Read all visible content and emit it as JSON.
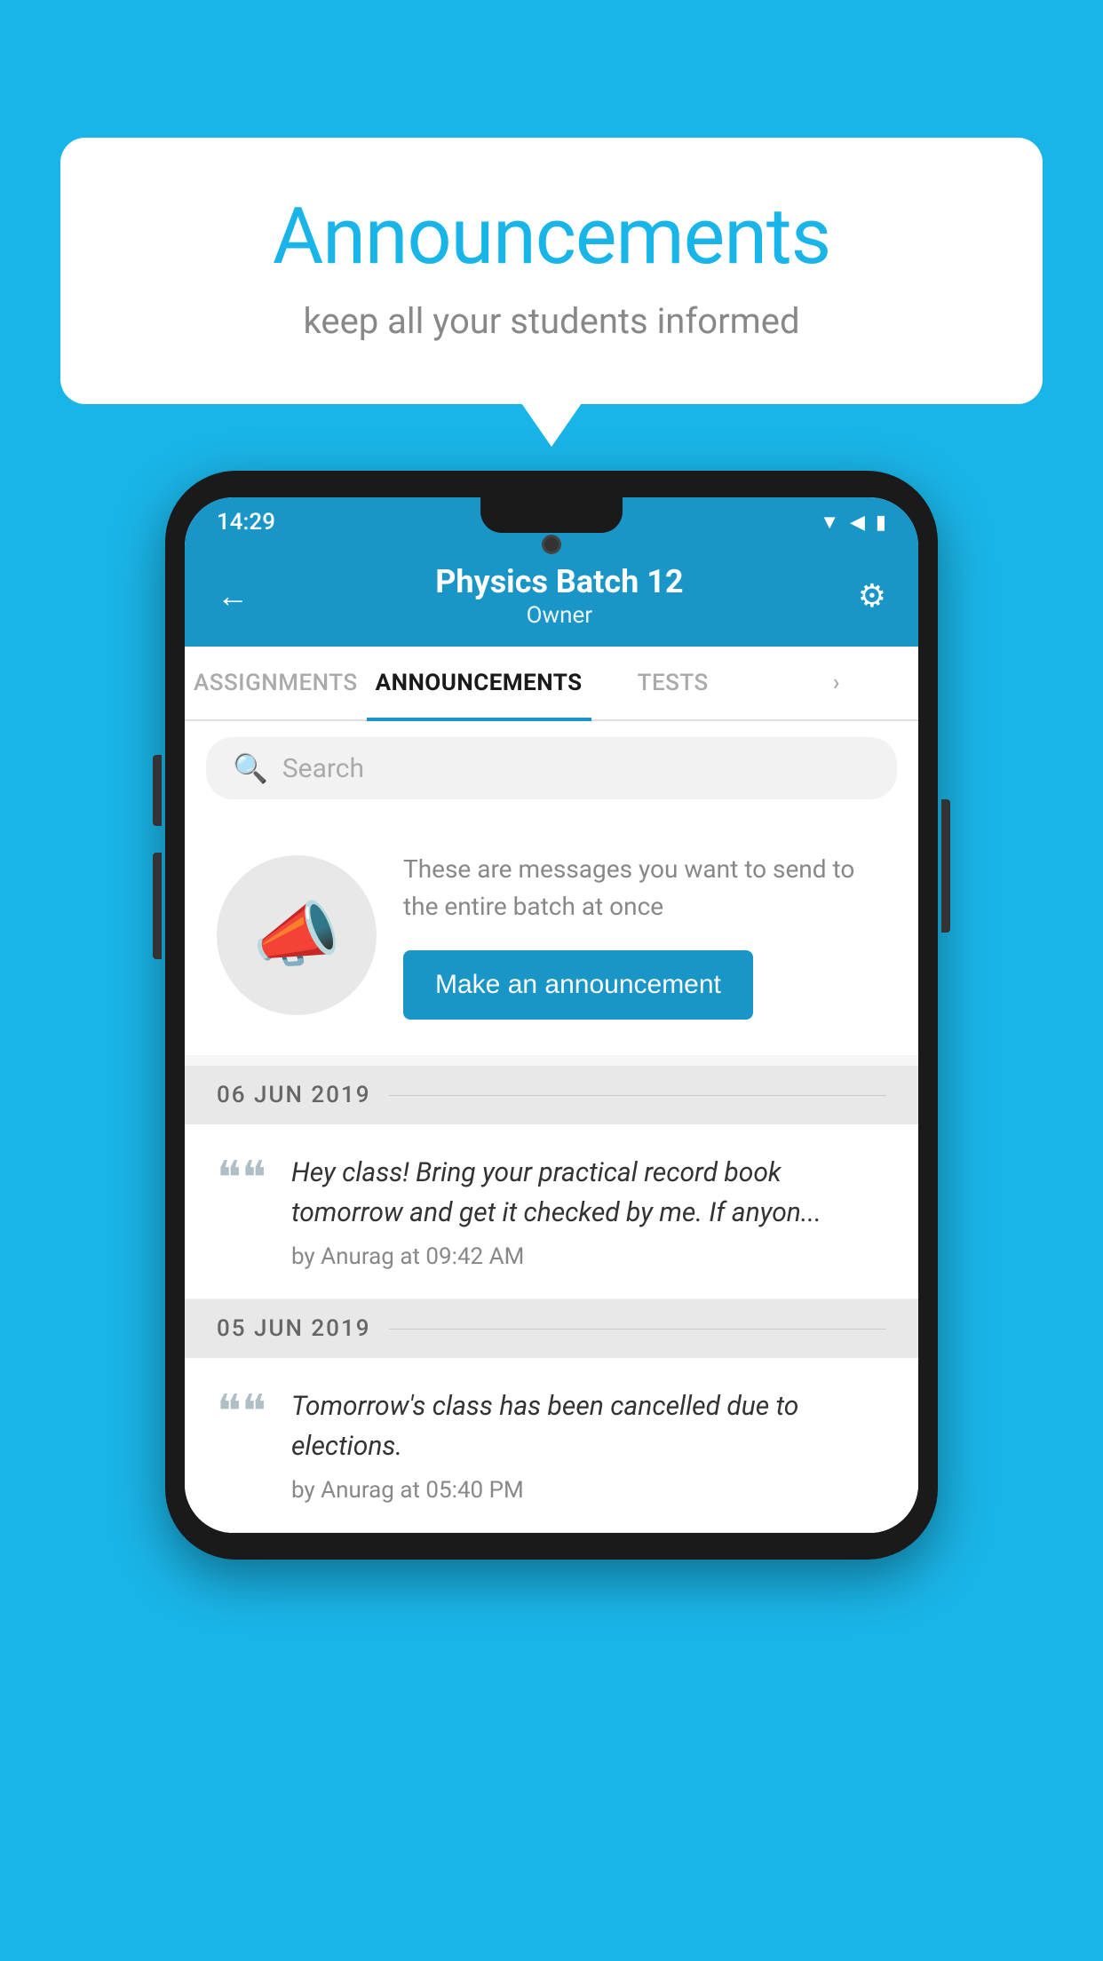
{
  "background_color": "#1ab5e8",
  "bubble": {
    "title": "Announcements",
    "subtitle": "keep all your students informed"
  },
  "phone": {
    "status_bar": {
      "time": "14:29",
      "wifi": "▲",
      "signal": "▲",
      "battery": "▮"
    },
    "app_bar": {
      "title": "Physics Batch 12",
      "subtitle": "Owner",
      "back_label": "←",
      "settings_label": "⚙"
    },
    "tabs": [
      {
        "label": "ASSIGNMENTS",
        "active": false
      },
      {
        "label": "ANNOUNCEMENTS",
        "active": true
      },
      {
        "label": "TESTS",
        "active": false
      },
      {
        "label": "›",
        "active": false
      }
    ],
    "search": {
      "placeholder": "Search"
    },
    "promo": {
      "description": "These are messages you want to send to the entire batch at once",
      "button_label": "Make an announcement"
    },
    "announcements": [
      {
        "date": "06  JUN  2019",
        "text": "Hey class! Bring your practical record book tomorrow and get it checked by me. If anyon...",
        "author": "by Anurag at 09:42 AM"
      },
      {
        "date": "05  JUN  2019",
        "text": "Tomorrow's class has been cancelled due to elections.",
        "author": "by Anurag at 05:40 PM"
      }
    ]
  }
}
